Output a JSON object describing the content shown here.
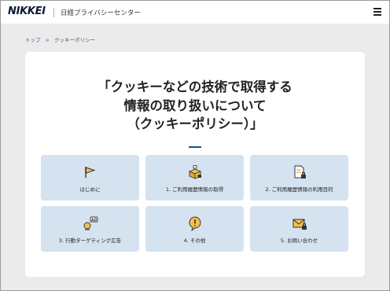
{
  "header": {
    "logo": "NIKKEI",
    "site_name": "日経プライバシーセンター",
    "menu_icon": "hamburger-menu-icon"
  },
  "breadcrumb": {
    "home": "トップ",
    "separator": ">",
    "current": "クッキーポリシー"
  },
  "page": {
    "title_line1": "「クッキーなどの技術で取得する",
    "title_line2": "情報の取り扱いについて",
    "title_line3": "（クッキーポリシー）」",
    "accent_color": "#1f4e8c"
  },
  "tiles": [
    {
      "label": "はじめに",
      "icon": "flag-icon"
    },
    {
      "label": "1. ご利用履歴情報の取得",
      "icon": "box-collect-icon"
    },
    {
      "label": "2. ご利用履歴情報の利用目的",
      "icon": "document-lock-icon"
    },
    {
      "label": "3. 行動ターゲティング広告",
      "icon": "ad-target-icon"
    },
    {
      "label": "4. その他",
      "icon": "exclamation-bubble-icon"
    },
    {
      "label": "5. お問い合わせ",
      "icon": "envelope-lock-icon"
    }
  ],
  "colors": {
    "page_background": "#ebebeb",
    "tile_background": "#d5e2f0",
    "logo": "#0e1a3a"
  }
}
